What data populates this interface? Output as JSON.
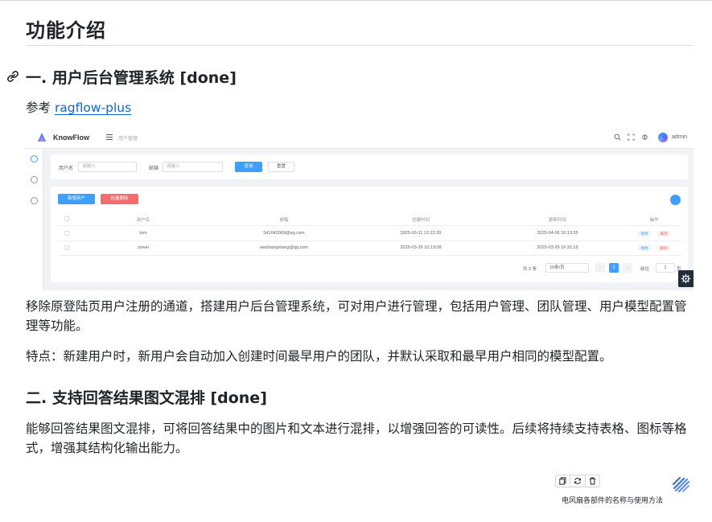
{
  "doc": {
    "title": "功能介绍",
    "section1": {
      "heading": "一. 用户后台管理系统 [done]",
      "ref_prefix": "参考 ",
      "ref_link": "ragflow-plus",
      "desc": "移除原登陆页用户注册的通道，搭建用户后台管理系统，可对用户进行管理，包括用户管理、团队管理、用户模型配置管理等功能。",
      "feature": "特点：新建用户时，新用户会自动加入创建时间最早用户的团队，并默认采取和最早用户相同的模型配置。"
    },
    "section2": {
      "heading": "二. 支持回答结果图文混排 [done]",
      "desc": "能够回答结果图文混排，可将回答结果中的图片和文本进行混排，以增强回答的可读性。后续将持续支持表格、图标等格式，增强其结构化输出能力。"
    }
  },
  "screenshot": {
    "brand": "KnowFlow",
    "breadcrumb": "用户管理",
    "user": "admin",
    "filters": {
      "username_label": "用户名",
      "username_placeholder": "请输入",
      "email_label": "邮箱",
      "email_placeholder": "请输入",
      "search_label": "查询",
      "reset_label": "重置"
    },
    "actions": {
      "add_label": "新增用户",
      "batch_delete_label": "批量删除"
    },
    "table": {
      "headers": [
        "用户名",
        "邮箱",
        "创建时间",
        "更新时间",
        "操作"
      ],
      "rows": [
        {
          "name": "tom",
          "email": "541642069@qq.com",
          "created": "2025-03-11 12:22:20",
          "updated": "2025-04-06 10:13:35"
        },
        {
          "name": "zxwei",
          "email": "weizhangxiang@qq.com",
          "created": "2025-03-29 10:13:08",
          "updated": "2025-03-29 16:31:16"
        }
      ],
      "edit_label": "修改",
      "delete_label": "删除"
    },
    "pagination": {
      "total": "共 2 条",
      "page_size": "10条/页",
      "current_page": "1",
      "goto_label": "前往",
      "goto_value": "1",
      "page_suffix": "页"
    }
  },
  "widget": {
    "caption": "电风扇各部件的名称与使用方法"
  },
  "colors": {
    "link": "#0969da",
    "primary": "#409eff",
    "danger": "#f56c6c"
  }
}
